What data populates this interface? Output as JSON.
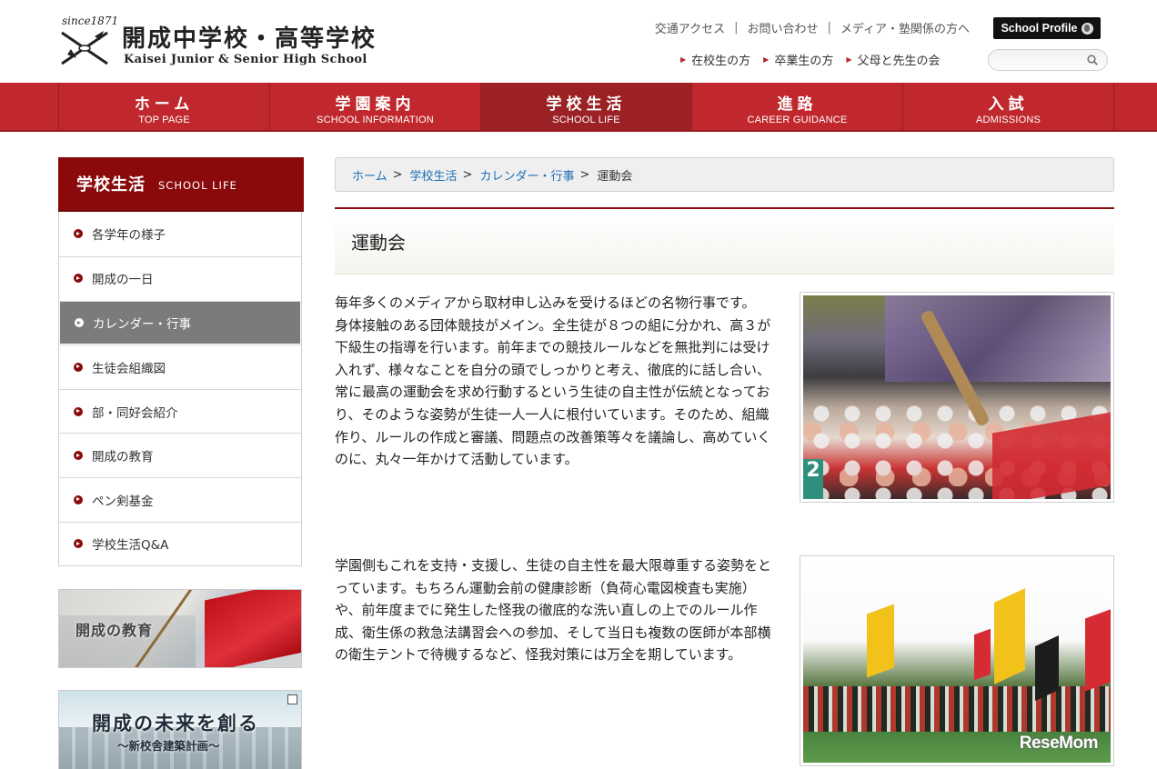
{
  "header": {
    "since": "since1871",
    "logo_ja": "開成中学校・高等学校",
    "logo_en": "Kaisei Junior & Senior High School",
    "top_links": [
      "交通アクセス",
      "お問い合わせ",
      "メディア・塾関係の方へ"
    ],
    "profile_button": "School Profile",
    "sub_links": [
      "在校生の方",
      "卒業生の方",
      "父母と先生の会"
    ],
    "search_placeholder": ""
  },
  "nav": [
    {
      "ja": "ホーム",
      "en": "TOP PAGE",
      "active": false
    },
    {
      "ja": "学園案内",
      "en": "SCHOOL INFORMATION",
      "active": false
    },
    {
      "ja": "学校生活",
      "en": "SCHOOL LIFE",
      "active": true
    },
    {
      "ja": "進路",
      "en": "CAREER GUIDANCE",
      "active": false
    },
    {
      "ja": "入試",
      "en": "ADMISSIONS",
      "active": false
    }
  ],
  "sidebar": {
    "title_ja": "学校生活",
    "title_en": "SCHOOL LIFE",
    "items": [
      {
        "label": "各学年の様子",
        "active": false
      },
      {
        "label": "開成の一日",
        "active": false
      },
      {
        "label": "カレンダー・行事",
        "active": true
      },
      {
        "label": "生徒会組織図",
        "active": false
      },
      {
        "label": "部・同好会紹介",
        "active": false
      },
      {
        "label": "開成の教育",
        "active": false
      },
      {
        "label": "ペン剣基金",
        "active": false
      },
      {
        "label": "学校生活Q&A",
        "active": false
      }
    ],
    "banner1_text": "開成の教育",
    "banner2_title": "開成の未来を創る",
    "banner2_sub": "〜新校舎建築計画〜"
  },
  "breadcrumb": {
    "items": [
      "ホーム",
      "学校生活",
      "カレンダー・行事"
    ],
    "current": "運動会"
  },
  "page_title": "運動会",
  "content": {
    "para1_line1": "毎年多くのメディアから取材申し込みを受けるほどの名物行事です。",
    "para1_line2": "身体接触のある団体競技がメイン。全生徒が８つの組に分かれ、高３が下級生の指導を行います。前年までの競技ルールなどを無批判には受け入れず、様々なことを自分の頭でしっかりと考え、徹底的に話し合い、常に最高の運動会を求め行動するという生徒の自主性が伝統となっており、そのような姿勢が生徒一人一人に根付いています。そのため、組織作り、ルールの作成と審議、問題点の改善策等々を議論し、高めていくのに、丸々一年かけて活動しています。",
    "para2": "学園側もこれを支持・支援し、生徒の自主性を最大限尊重する姿勢をとっています。もちろん運動会前の健康診断（負荷心電図検査も実施）や、前年度までに発生した怪我の徹底的な洗い直しの上でのルール作成、衛生係の救急法講習会への参加、そして当日も複数の医師が本部横の衛生テントで待機するなど、怪我対策には万全を期しています。",
    "photo1_number": "2"
  },
  "watermark": "ReseMom",
  "colors": {
    "accent": "#c0282e",
    "accent_dark": "#8a0a0c",
    "link": "#1d6fb8"
  }
}
